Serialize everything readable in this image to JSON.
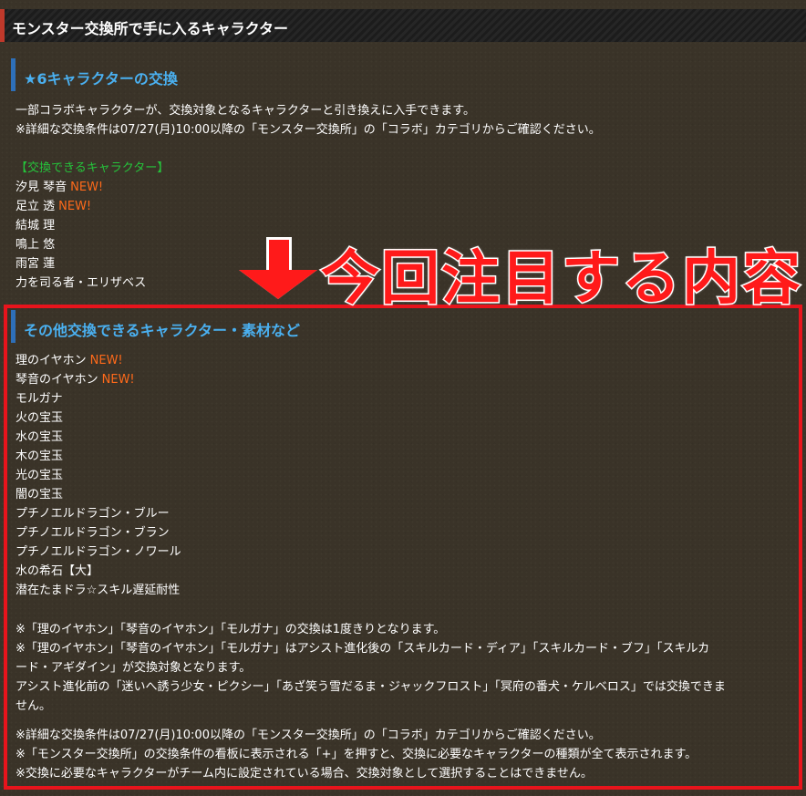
{
  "page_title": "モンスター交換所で手に入るキャラクター",
  "section1": {
    "title": "★6キャラクターの交換",
    "desc1": "一部コラボキャラクターが、交換対象となるキャラクターと引き換えに入手できます。",
    "desc2": "※詳細な交換条件は07/27(月)10:00以降の「モンスター交換所」の「コラボ」カテゴリからご確認ください。",
    "list_heading": "【交換できるキャラクター】",
    "characters": [
      {
        "name": "汐見 琴音",
        "badge": "NEW!"
      },
      {
        "name": "足立 透",
        "badge": "NEW!"
      },
      {
        "name": "結城 理"
      },
      {
        "name": "鳴上 悠"
      },
      {
        "name": "雨宮 蓮"
      },
      {
        "name": "力を司る者・エリザベス"
      }
    ]
  },
  "callout": {
    "text": "今回注目する内容",
    "arrow_icon": "down-arrow-icon",
    "color": "#ff1a1a"
  },
  "section2": {
    "title": "その他交換できるキャラクター・素材など",
    "items": [
      {
        "name": "理のイヤホン",
        "badge": "NEW!"
      },
      {
        "name": "琴音のイヤホン",
        "badge": "NEW!"
      },
      {
        "name": "モルガナ"
      },
      {
        "name": "火の宝玉"
      },
      {
        "name": "水の宝玉"
      },
      {
        "name": "木の宝玉"
      },
      {
        "name": "光の宝玉"
      },
      {
        "name": "闇の宝玉"
      },
      {
        "name": "プチノエルドラゴン・ブルー"
      },
      {
        "name": "プチノエルドラゴン・ブラン"
      },
      {
        "name": "プチノエルドラゴン・ノワール"
      },
      {
        "name": "水の希石【大】"
      },
      {
        "name": "潜在たまドラ☆スキル遅延耐性"
      }
    ],
    "note1": "※「理のイヤホン」「琴音のイヤホン」「モルガナ」の交換は1度きりとなります。",
    "note2a": "※「理のイヤホン」「琴音のイヤホン」「モルガナ」はアシスト進化後の「スキルカード・ディア」「スキルカード・ブフ」「スキルカ",
    "note2b": "ード・アギダイン」が交換対象となります。",
    "note3a": "アシスト進化前の「迷いへ誘う少女・ピクシー」「あざ笑う雪だるま・ジャックフロスト」「冥府の番犬・ケルベロス」では交換できま",
    "note3b": "せん。",
    "note4": "※詳細な交換条件は07/27(月)10:00以降の「モンスター交換所」の「コラボ」カテゴリからご確認ください。",
    "note5": "※「モンスター交換所」の交換条件の看板に表示される「+」を押すと、交換に必要なキャラクターの種類が全て表示されます。",
    "note6": "※交換に必要なキャラクターがチーム内に設定されている場合、交換対象として選択することはできません。"
  },
  "colors": {
    "accent_blue": "#4ab0f0",
    "new_badge": "#ff6a1a",
    "green_heading": "#25c43b",
    "highlight_border": "#e8141c"
  }
}
